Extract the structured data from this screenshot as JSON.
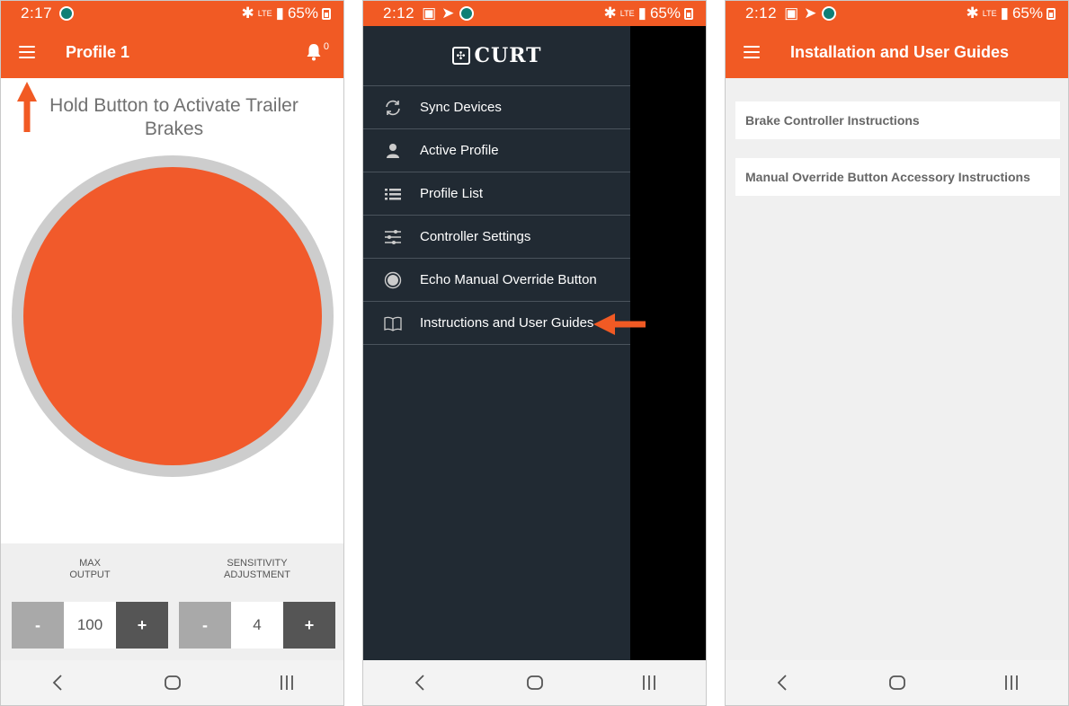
{
  "screen1": {
    "status": {
      "time": "2:17",
      "battery": "65%",
      "network": "LTE"
    },
    "appbar": {
      "title": "Profile 1",
      "notification_count": "0"
    },
    "instruction": "Hold Button to Activate Trailer Brakes",
    "max_output": {
      "label_line1": "MAX",
      "label_line2": "OUTPUT",
      "minus": "-",
      "value": "100",
      "plus": "+"
    },
    "sensitivity": {
      "label_line1": "SENSITIVITY",
      "label_line2": "ADJUSTMENT",
      "minus": "-",
      "value": "4",
      "plus": "+"
    }
  },
  "screen2": {
    "status": {
      "time": "2:12",
      "battery": "65%",
      "network": "LTE"
    },
    "logo": "CURT",
    "menu": [
      {
        "label": "Sync Devices",
        "icon": "sync-icon"
      },
      {
        "label": "Active Profile",
        "icon": "person-icon"
      },
      {
        "label": "Profile List",
        "icon": "list-icon"
      },
      {
        "label": "Controller Settings",
        "icon": "sliders-icon"
      },
      {
        "label": "Echo Manual Override Button",
        "icon": "radio-button-icon"
      },
      {
        "label": "Instructions and User Guides",
        "icon": "book-icon"
      }
    ]
  },
  "screen3": {
    "status": {
      "time": "2:12",
      "battery": "65%",
      "network": "LTE"
    },
    "appbar": {
      "title": "Installation and User Guides"
    },
    "guides": [
      {
        "label": "Brake Controller Instructions"
      },
      {
        "label": "Manual Override Button Accessory Instructions"
      }
    ]
  },
  "colors": {
    "accent": "#f15a24",
    "drawer": "#212a33",
    "button_light": "#a9a9a9",
    "button_dark": "#555555"
  }
}
